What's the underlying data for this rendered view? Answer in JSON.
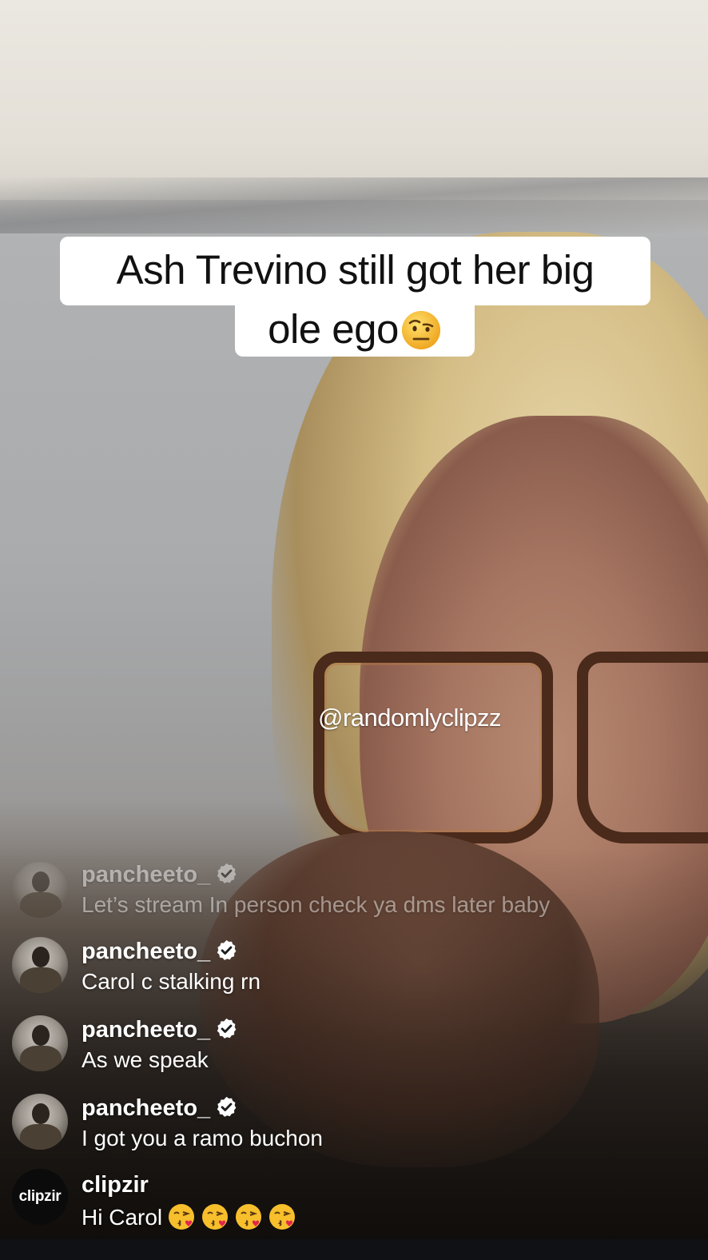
{
  "caption": {
    "line1": "Ash Trevino still got her big",
    "line2": "ole ego",
    "emoji": "raised-eyebrow-emoji"
  },
  "watermark": "@randomlyclipzz",
  "comments": [
    {
      "username": "pancheeto_",
      "message": "Let’s stream In person check ya dms later baby",
      "verified": true,
      "avatar": "profile-photo",
      "faded": true
    },
    {
      "username": "pancheeto_",
      "message": "Carol c stalking rn",
      "verified": true,
      "avatar": "profile-photo"
    },
    {
      "username": "pancheeto_",
      "message": "As we speak",
      "verified": true,
      "avatar": "profile-photo"
    },
    {
      "username": "pancheeto_",
      "message": "I got you a ramo buchon",
      "verified": true,
      "avatar": "profile-photo"
    },
    {
      "username": "clipzir",
      "message": "Hi Carol",
      "avatar_text": "clipzir",
      "emojis": [
        "kissing-heart-emoji",
        "kissing-heart-emoji",
        "kissing-heart-emoji",
        "kissing-heart-emoji"
      ]
    }
  ],
  "colors": {
    "caption_bg": "#ffffff",
    "caption_text": "#111111",
    "verified_badge": "#ffffff"
  }
}
